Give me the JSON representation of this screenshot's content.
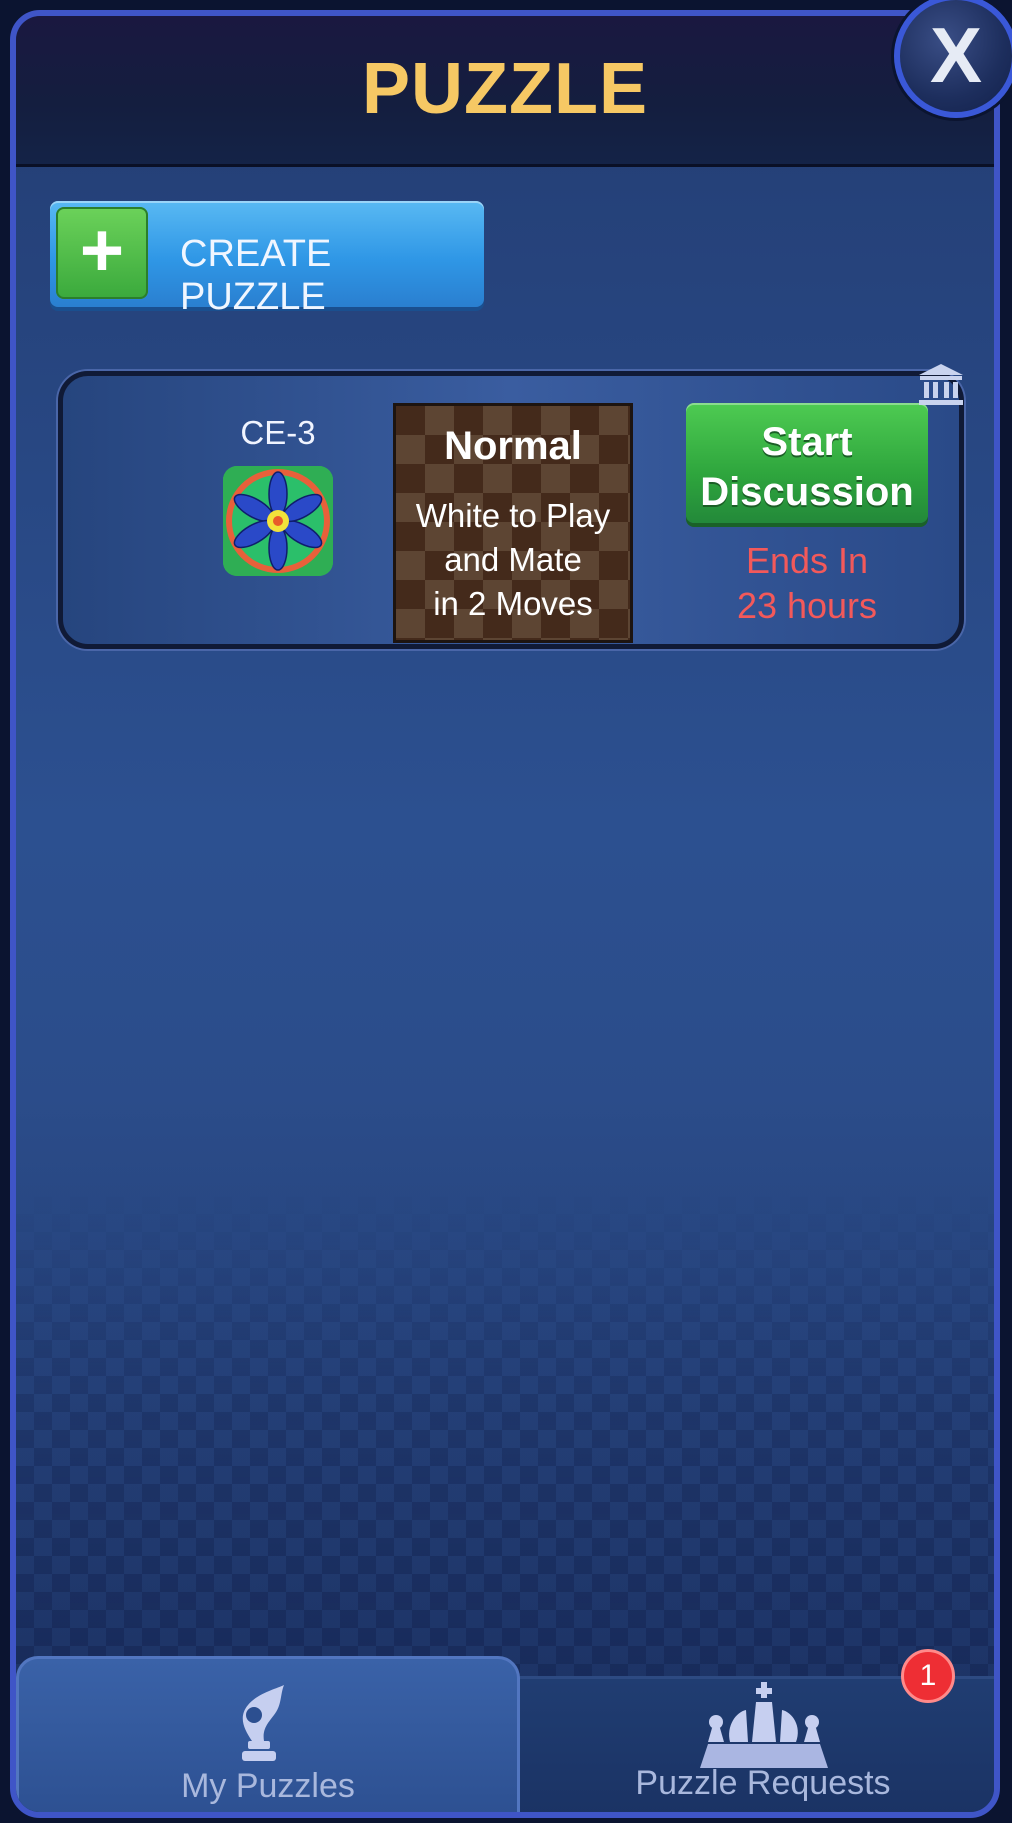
{
  "header": {
    "title": "PUZZLE",
    "close_label": "X"
  },
  "create_button": {
    "label": "CREATE PUZZLE",
    "plus": "+"
  },
  "puzzle_card": {
    "player_name": "CE-3",
    "mode_title": "Normal",
    "description": "White to Play\nand Mate\nin 2 Moves",
    "action_label": "Start\nDiscussion",
    "ends_text": "Ends In\n23 hours",
    "icons": {
      "delete": "museum-icon"
    }
  },
  "tabs": [
    {
      "label": "My Puzzles",
      "active": true,
      "icon": "puzzle-piece-icon"
    },
    {
      "label": "Puzzle Requests",
      "active": false,
      "icon": "chess-pieces-icon",
      "badge": "1"
    }
  ],
  "colors": {
    "title": "#f6c864",
    "ends_text": "#f3595a",
    "accent_frame": "#3f55c7"
  }
}
